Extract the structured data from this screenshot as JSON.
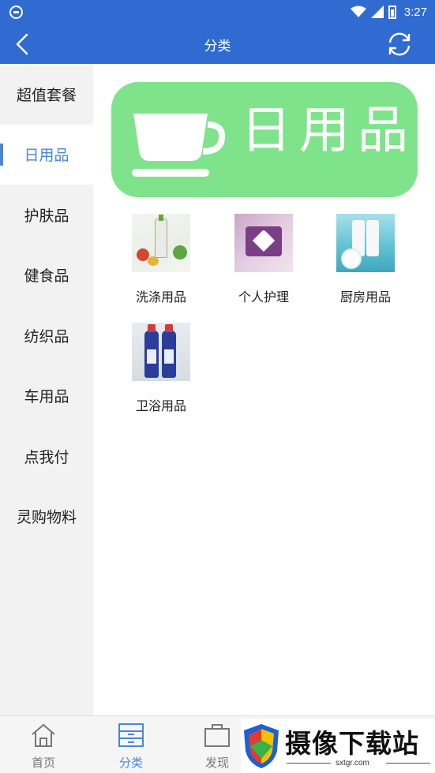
{
  "status_bar": {
    "time": "3:27"
  },
  "header": {
    "title": "分类",
    "back_icon": "chevron-left-icon",
    "refresh_icon": "refresh-icon"
  },
  "sidebar": {
    "items": [
      {
        "label": "超值套餐",
        "active": false
      },
      {
        "label": "日用品",
        "active": true
      },
      {
        "label": "护肤品",
        "active": false
      },
      {
        "label": "健食品",
        "active": false
      },
      {
        "label": "纺织品",
        "active": false
      },
      {
        "label": "车用品",
        "active": false
      },
      {
        "label": "点我付",
        "active": false
      },
      {
        "label": "灵购物料",
        "active": false
      }
    ]
  },
  "banner": {
    "text": "日用品",
    "bg_color": "#7ee38a"
  },
  "categories": [
    {
      "label": "洗涤用品"
    },
    {
      "label": "个人护理"
    },
    {
      "label": "厨房用品"
    },
    {
      "label": "卫浴用品"
    }
  ],
  "tabbar": {
    "tabs": [
      {
        "label": "首页",
        "icon": "home-icon",
        "active": false
      },
      {
        "label": "分类",
        "icon": "category-icon",
        "active": true
      },
      {
        "label": "发现",
        "icon": "bag-icon",
        "active": false
      }
    ]
  },
  "watermark": {
    "text": "摄像下载站",
    "url": "sxtgr.com"
  },
  "colors": {
    "primary": "#2f6bd0",
    "accent": "#4a86d6",
    "sidebar_bg": "#f2f2f2"
  }
}
